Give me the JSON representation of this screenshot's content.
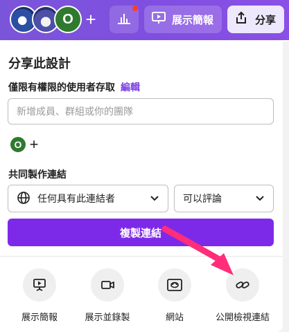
{
  "topbar": {
    "avatars": [
      {
        "name": "avatar-1"
      },
      {
        "name": "avatar-2"
      },
      {
        "initial": "O"
      }
    ],
    "add_label": "+",
    "present_label": "展示簡報",
    "share_label": "分享",
    "accent_color": "#7b55d9",
    "notification_color": "#ff3b30"
  },
  "panel": {
    "title": "分享此設計",
    "access_text": "僅限有權限的使用者存取",
    "edit_link": "編輯",
    "invite_placeholder": "新增成員、群組或你的團隊",
    "collaborator_initial": "O",
    "collaborator_add": "+",
    "collab_link_title": "共同製作連結",
    "link_access_value": "任何具有此連結者",
    "permission_value": "可以評論",
    "copy_button": "複製連結",
    "copy_button_color": "#7d2ae8",
    "options": [
      {
        "label": "展示簡報",
        "icon": "present-icon"
      },
      {
        "label": "展示並錄製",
        "icon": "video-icon"
      },
      {
        "label": "網站",
        "icon": "website-icon"
      },
      {
        "label": "公開檢視連結",
        "icon": "link-icon"
      }
    ]
  }
}
